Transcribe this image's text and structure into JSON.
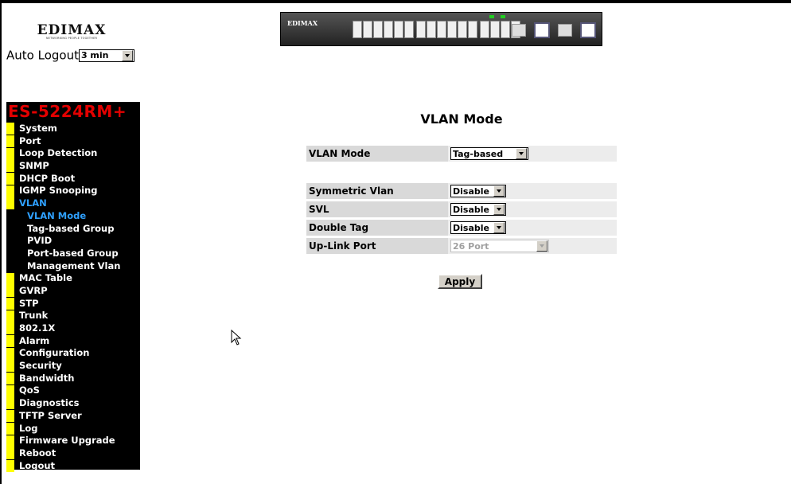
{
  "header": {
    "logo_text": "EDIMAX",
    "logo_tagline": "NETWORKING PEOPLE TOGETHER",
    "auto_logout_label": "Auto Logout",
    "auto_logout_value": "3 min",
    "device_brand": "EDIMAX"
  },
  "sidebar": {
    "model": "ES-5224RM+",
    "items": [
      {
        "label": "System",
        "sub": false
      },
      {
        "label": "Port",
        "sub": false
      },
      {
        "label": "Loop Detection",
        "sub": false
      },
      {
        "label": "SNMP",
        "sub": false
      },
      {
        "label": "DHCP Boot",
        "sub": false
      },
      {
        "label": "IGMP Snooping",
        "sub": false
      },
      {
        "label": "VLAN",
        "sub": false,
        "active": true
      },
      {
        "label": "VLAN Mode",
        "sub": true,
        "active": true
      },
      {
        "label": "Tag-based Group",
        "sub": true
      },
      {
        "label": "PVID",
        "sub": true
      },
      {
        "label": "Port-based Group",
        "sub": true
      },
      {
        "label": "Management Vlan",
        "sub": true
      },
      {
        "label": "MAC Table",
        "sub": false
      },
      {
        "label": "GVRP",
        "sub": false
      },
      {
        "label": "STP",
        "sub": false
      },
      {
        "label": "Trunk",
        "sub": false
      },
      {
        "label": "802.1X",
        "sub": false
      },
      {
        "label": "Alarm",
        "sub": false
      },
      {
        "label": "Configuration",
        "sub": false
      },
      {
        "label": "Security",
        "sub": false
      },
      {
        "label": "Bandwidth",
        "sub": false
      },
      {
        "label": "QoS",
        "sub": false
      },
      {
        "label": "Diagnostics",
        "sub": false
      },
      {
        "label": "TFTP Server",
        "sub": false
      },
      {
        "label": "Log",
        "sub": false
      },
      {
        "label": "Firmware Upgrade",
        "sub": false
      },
      {
        "label": "Reboot",
        "sub": false
      },
      {
        "label": "Logout",
        "sub": false
      }
    ]
  },
  "main": {
    "title": "VLAN Mode",
    "vlan_mode": {
      "label": "VLAN Mode",
      "value": "Tag-based"
    },
    "symmetric_vlan": {
      "label": "Symmetric Vlan",
      "value": "Disable"
    },
    "svl": {
      "label": "SVL",
      "value": "Disable"
    },
    "double_tag": {
      "label": "Double Tag",
      "value": "Disable"
    },
    "uplink_port": {
      "label": "Up-Link Port",
      "value": "26 Port",
      "disabled": true
    },
    "apply_label": "Apply"
  },
  "colors": {
    "sidebar_bg": "#000000",
    "model_red": "#e20000",
    "menu_marker": "#ffff00",
    "active_blue": "#2fa0ff",
    "label_cell": "#d9d9d9",
    "control_cell": "#ececec"
  },
  "icons": {
    "cursor": "mouse-pointer-icon",
    "dropdown": "chevron-down-icon"
  }
}
